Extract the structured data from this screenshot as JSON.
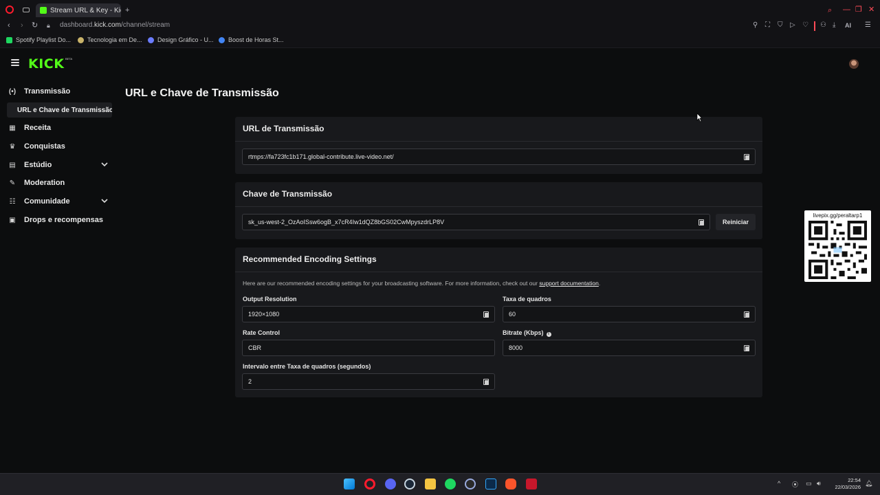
{
  "browser": {
    "tab_title": "Stream URL & Key - Kick D",
    "url_prefix": "dashboard.",
    "url_domain": "kick.com",
    "url_path": "/channel/stream",
    "bookmarks": [
      {
        "label": "Spotify Playlist Do...",
        "icon": "spotify-icon",
        "color": "#1ed760"
      },
      {
        "label": "Tecnologia em De...",
        "icon": "bookmark-icon",
        "color": "#c9b36a"
      },
      {
        "label": "Design Gráfico - U...",
        "icon": "design-icon",
        "color": "#6b7cff"
      },
      {
        "label": "Boost de Horas St...",
        "icon": "google-icon",
        "color": "#4285f4"
      }
    ],
    "ai_label": "AI"
  },
  "app": {
    "logo": "KICK",
    "logo_badge": "BETA"
  },
  "sidebar": {
    "transmissao": "Transmissão",
    "sub_active": "URL e Chave de Transmissão",
    "receita": "Receita",
    "conquistas": "Conquistas",
    "estudio": "Estúdio",
    "moderation": "Moderation",
    "comunidade": "Comunidade",
    "drops": "Drops e recompensas"
  },
  "main": {
    "page_title": "URL e Chave de Transmissão",
    "url_section": {
      "title": "URL de Transmissão",
      "value": "rtmps://fa723fc1b171.global-contribute.live-video.net/"
    },
    "key_section": {
      "title": "Chave de Transmissão",
      "value": "sk_us-west-2_OzAoISsw6ogB_x7cR4Iw1dQZ8bGS02CwMpyszdrLP8V",
      "reset_label": "Reiniciar"
    },
    "encoding": {
      "title": "Recommended Encoding Settings",
      "note_text": "Here are our recommended encoding settings for your broadcasting software. For more information, check out our ",
      "note_link": "support documentation",
      "note_end": ".",
      "output_resolution_label": "Output Resolution",
      "output_resolution_value": "1920×1080",
      "fps_label": "Taxa de quadros",
      "fps_value": "60",
      "rate_control_label": "Rate Control",
      "rate_control_value": "CBR",
      "bitrate_label": "Bitrate (Kbps)",
      "bitrate_value": "8000",
      "keyframe_label": "Intervalo entre Taxa de quadros (segundos)",
      "keyframe_value": "2"
    }
  },
  "overlay": {
    "qr_caption": "livepix.gg/peraltarp1"
  },
  "taskbar": {
    "time": "22:54",
    "date": "22/03/2026"
  }
}
